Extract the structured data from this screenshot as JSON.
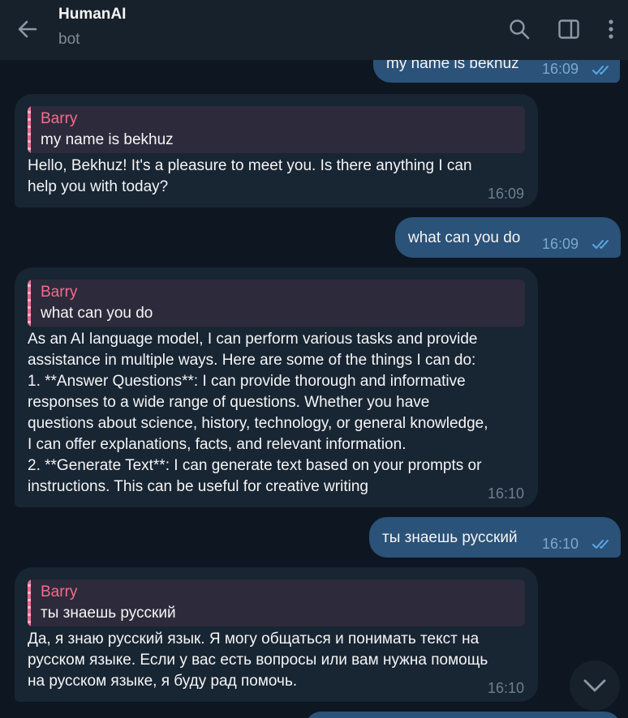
{
  "header": {
    "title": "HumanAI",
    "subtitle": "bot",
    "icons": [
      "back-arrow-icon",
      "search-icon",
      "sidebar-toggle-icon",
      "more-vertical-icon"
    ]
  },
  "messages": [
    {
      "direction": "out",
      "text": "my name is bekhuz",
      "time": "16:09",
      "status": "read"
    },
    {
      "direction": "in",
      "reply_name": "Barry",
      "reply_text": "my name is bekhuz",
      "text": "Hello, Bekhuz! It's a pleasure to meet you. Is there anything I can\nhelp you with today?",
      "time": "16:09"
    },
    {
      "direction": "out",
      "text": "what can you do",
      "time": "16:09",
      "status": "read"
    },
    {
      "direction": "in",
      "reply_name": "Barry",
      "reply_text": "what can you do",
      "text": "As an AI language model, I can perform various tasks and provide\nassistance in multiple ways. Here are some of the things I can do:\n1. **Answer Questions**: I can provide thorough and informative\nresponses to a wide range of questions. Whether you have\nquestions about science, history, technology, or general knowledge,\nI can offer explanations, facts, and relevant information.\n2. **Generate Text**: I can generate text based on your prompts or\ninstructions. This can be useful for creative writing",
      "time": "16:10"
    },
    {
      "direction": "out",
      "text": "ты знаешь русский",
      "time": "16:10",
      "status": "read"
    },
    {
      "direction": "in",
      "reply_name": "Barry",
      "reply_text": "ты знаешь русский",
      "text": "Да, я знаю русский язык. Я могу общаться и понимать текст на\nрусском языке. Если у вас есть вопросы или вам нужна помощь\nна русском языке, я буду рад помочь.",
      "time": "16:10"
    }
  ],
  "colors": {
    "background": "#0e1621",
    "header": "#17212b",
    "outgoing_bubble": "#2b5278",
    "incoming_bubble": "#182533",
    "reply_name": "#f26d8e",
    "read_checks": "#5ea6e6"
  },
  "scroll_button": {
    "icon": "chevron-down-icon"
  }
}
